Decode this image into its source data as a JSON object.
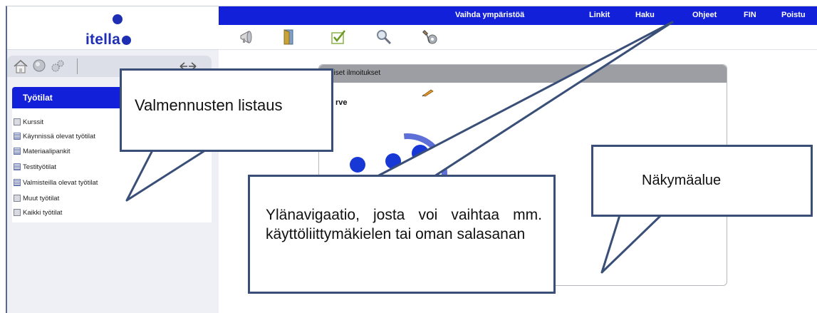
{
  "logo": {
    "text": "itella"
  },
  "topnav": {
    "env_switch": "Vaihda ympäristöä",
    "links": "Linkit",
    "search": "Haku",
    "help": "Ohjeet",
    "language": "FIN",
    "logout": "Poistu"
  },
  "toolbar": {
    "icons": [
      "megaphone-icon",
      "door-icon",
      "checkmark-icon",
      "magnifier-icon",
      "tools-icon"
    ]
  },
  "left_tools": {
    "icons": [
      "home-icon",
      "people-icon",
      "gear-icon",
      "collapse-arrows-icon"
    ]
  },
  "workspaces": {
    "title": "Työtilat",
    "items": [
      "Kurssit",
      "Käynnissä olevat työtilat",
      "Materiaalipankit",
      "Testityötilat",
      "Valmisteilla olevat työtilat",
      "Muut työtilat",
      "Kaikki työtilat"
    ]
  },
  "main": {
    "panel_title": "eiset ilmoitukset",
    "welcome": "rve"
  },
  "callouts": {
    "list": "Valmennusten listaus",
    "view": "Näkymäalue",
    "nav": "Ylänavigaatio, josta voi vaihtaa mm. käyttöliittymäkielen tai oman salasanan"
  },
  "colors": {
    "nav_blue": "#1220d9",
    "logo_blue": "#1f2fb3",
    "callout_border": "#3a4f78",
    "panel_gray": "#9c9ea3"
  }
}
